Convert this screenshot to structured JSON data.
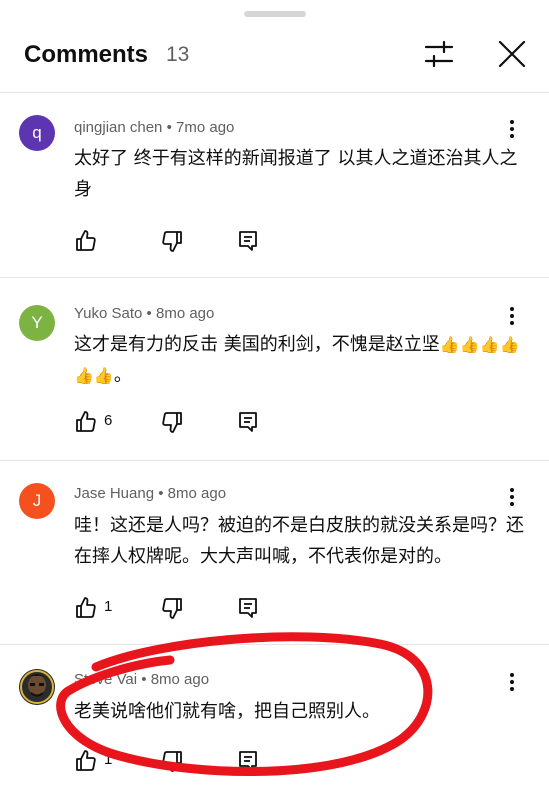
{
  "header": {
    "title": "Comments",
    "count": "13",
    "filter_icon": "sliders-icon",
    "close_icon": "close-icon"
  },
  "comments": [
    {
      "avatar_letter": "q",
      "avatar_color": "#5e35b1",
      "author": "qingjian chen",
      "time": "7mo ago",
      "text": "太好了  终于有这样的新闻报道了  以其人之道还治其人之身",
      "likes": ""
    },
    {
      "avatar_letter": "Y",
      "avatar_color": "#7cb342",
      "author": "Yuko Sato",
      "time": "8mo ago",
      "text": "这才是有力的反击 美国的利剑，不愧是赵立坚",
      "text_suffix": "。",
      "likes": "6"
    },
    {
      "avatar_letter": "J",
      "avatar_color": "#f4511e",
      "author": "Jase Huang",
      "time": "8mo ago",
      "text": "哇！这还是人吗？被迫的不是白皮肤的就没关系是吗？还在摔人权牌呢。大大声叫喊，不代表你是对的。",
      "likes": "1"
    },
    {
      "avatar_letter": "",
      "avatar_color": "#3a3a3a",
      "author": "Steve Vai",
      "time": "8mo ago",
      "text": "老美说啥他们就有啥，把自己照别人。",
      "likes": "1"
    }
  ],
  "colors": {
    "annotation": "#e8151c",
    "meta_text": "#606060"
  }
}
